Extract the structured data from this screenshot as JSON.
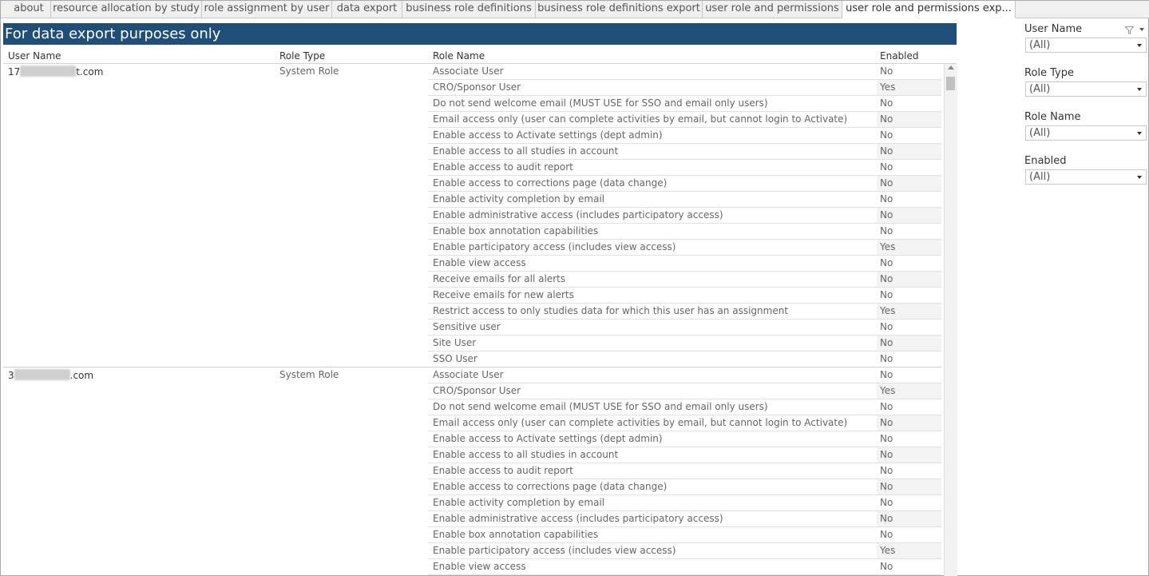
{
  "tabs": [
    {
      "label": "about"
    },
    {
      "label": "resource allocation by study"
    },
    {
      "label": "role assignment by user"
    },
    {
      "label": "data export"
    },
    {
      "label": "business role definitions"
    },
    {
      "label": "business role definitions export"
    },
    {
      "label": "user role and permissions"
    },
    {
      "label": "user role and permissions exp..."
    }
  ],
  "banner": "For data export purposes only",
  "columns": {
    "user_name": "User Name",
    "role_type": "Role Type",
    "role_name": "Role Name",
    "enabled": "Enabled"
  },
  "groups": [
    {
      "user_prefix": "17",
      "user_suffix": "t.com",
      "role_type": "System Role",
      "rows": [
        {
          "role": "Associate User",
          "enabled": "No"
        },
        {
          "role": "CRO/Sponsor User",
          "enabled": "Yes"
        },
        {
          "role": "Do not send welcome email (MUST USE for SSO and email only users)",
          "enabled": "No"
        },
        {
          "role": "Email access only (user can complete activities by email, but cannot login to Activate)",
          "enabled": "No"
        },
        {
          "role": "Enable access to Activate settings (dept admin)",
          "enabled": "No"
        },
        {
          "role": "Enable access to all studies in account",
          "enabled": "No"
        },
        {
          "role": "Enable access to audit report",
          "enabled": "No"
        },
        {
          "role": "Enable access to corrections page (data change)",
          "enabled": "No"
        },
        {
          "role": "Enable activity completion by email",
          "enabled": "No"
        },
        {
          "role": "Enable administrative access (includes participatory access)",
          "enabled": "No"
        },
        {
          "role": "Enable box annotation capabilities",
          "enabled": "No"
        },
        {
          "role": "Enable participatory access (includes view access)",
          "enabled": "Yes"
        },
        {
          "role": "Enable view access",
          "enabled": "No"
        },
        {
          "role": "Receive emails for all alerts",
          "enabled": "No"
        },
        {
          "role": "Receive emails for new alerts",
          "enabled": "No"
        },
        {
          "role": "Restrict access to only studies data for which this user has an assignment",
          "enabled": "Yes"
        },
        {
          "role": "Sensitive user",
          "enabled": "No"
        },
        {
          "role": "Site User",
          "enabled": "No"
        },
        {
          "role": "SSO User",
          "enabled": "No"
        }
      ]
    },
    {
      "user_prefix": "3",
      "user_suffix": ".com",
      "role_type": "System Role",
      "rows": [
        {
          "role": "Associate User",
          "enabled": "No"
        },
        {
          "role": "CRO/Sponsor User",
          "enabled": "Yes"
        },
        {
          "role": "Do not send welcome email (MUST USE for SSO and email only users)",
          "enabled": "No"
        },
        {
          "role": "Email access only (user can complete activities by email, but cannot login to Activate)",
          "enabled": "No"
        },
        {
          "role": "Enable access to Activate settings (dept admin)",
          "enabled": "No"
        },
        {
          "role": "Enable access to all studies in account",
          "enabled": "No"
        },
        {
          "role": "Enable access to audit report",
          "enabled": "No"
        },
        {
          "role": "Enable access to corrections page (data change)",
          "enabled": "No"
        },
        {
          "role": "Enable activity completion by email",
          "enabled": "No"
        },
        {
          "role": "Enable administrative access (includes participatory access)",
          "enabled": "No"
        },
        {
          "role": "Enable box annotation capabilities",
          "enabled": "No"
        },
        {
          "role": "Enable participatory access (includes view access)",
          "enabled": "Yes"
        },
        {
          "role": "Enable view access",
          "enabled": "No"
        }
      ]
    }
  ],
  "filters": [
    {
      "label": "User Name",
      "value": "(All)"
    },
    {
      "label": "Role Type",
      "value": "(All)"
    },
    {
      "label": "Role Name",
      "value": "(All)"
    },
    {
      "label": "Enabled",
      "value": "(All)"
    }
  ]
}
